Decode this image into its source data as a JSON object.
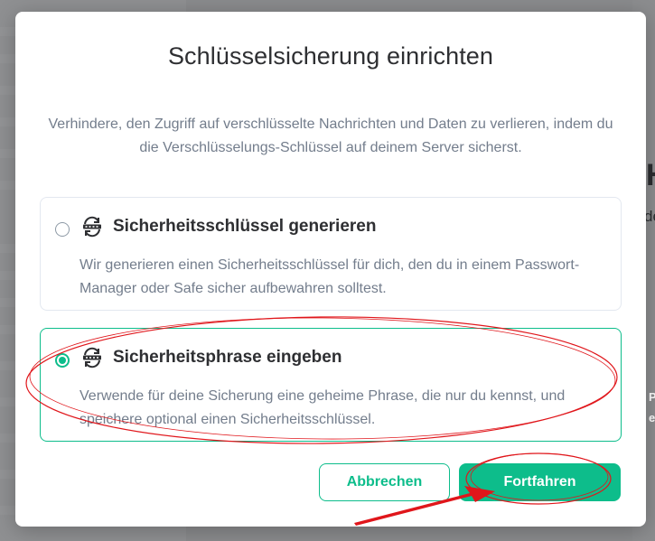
{
  "dialog": {
    "title": "Schlüsselsicherung einrichten",
    "description": "Verhindere, den Zugriff auf verschlüsselte Nachrichten und Daten zu verlieren, indem du die Verschlüsselungs-Schlüssel auf deinem Server sicherst.",
    "options": [
      {
        "title": "Sicherheitsschlüssel generieren",
        "description": "Wir generieren einen Sicherheitsschlüssel für dich, den du in einem Passwort-Manager oder Safe sicher aufbewahren solltest.",
        "selected": false,
        "icon": "key-sync-icon"
      },
      {
        "title": "Sicherheitsphrase eingeben",
        "description": "Verwende für deine Sicherung eine geheime Phrase, die nur du kennst, und speichere optional einen Sicherheitsschlüssel.",
        "selected": true,
        "icon": "password-sync-icon"
      }
    ],
    "buttons": {
      "cancel": "Abbrechen",
      "continue": "Fortfahren"
    }
  },
  "background": {
    "glyph_h": "H",
    "glyph_de": "de",
    "glyph_p": "P",
    "glyph_e": "e"
  },
  "colors": {
    "accent": "#0dbd8b",
    "annotation": "#e0161b"
  }
}
